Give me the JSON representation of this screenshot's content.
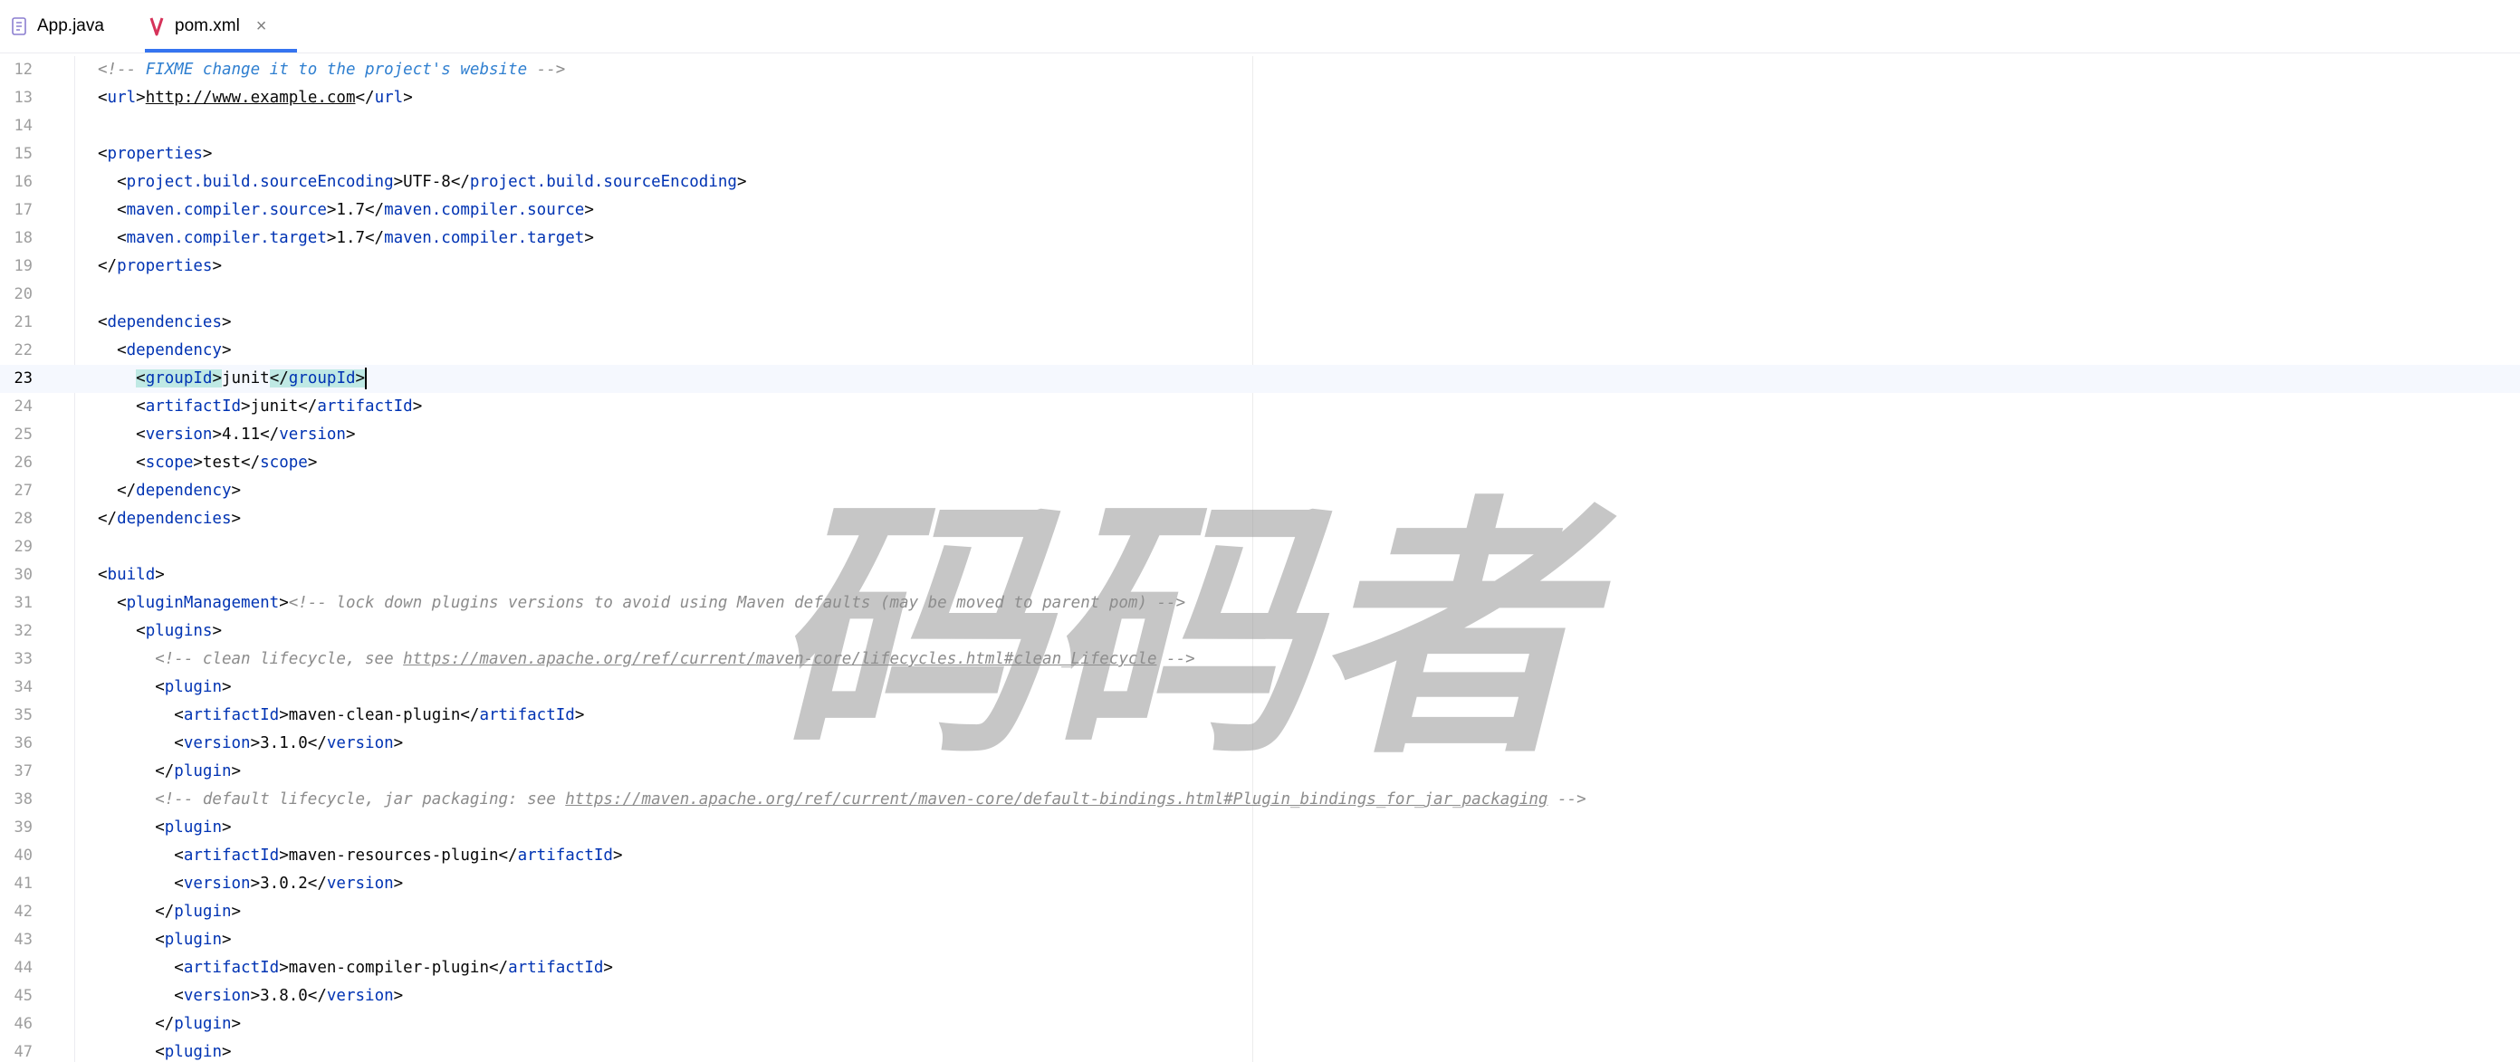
{
  "tabs": [
    {
      "label": "App.java",
      "icon": "java-file-icon",
      "active": false
    },
    {
      "label": "pom.xml",
      "icon": "maven-icon",
      "active": true,
      "close": "×"
    }
  ],
  "editor": {
    "current_line": 23,
    "lines": [
      {
        "n": "12",
        "code": "<!-- FIXME change it to the project's website -->"
      },
      {
        "n": "13",
        "code": "<url>http://www.example.com</url>"
      },
      {
        "n": "14",
        "code": ""
      },
      {
        "n": "15",
        "code": "<properties>"
      },
      {
        "n": "16",
        "code": "  <project.build.sourceEncoding>UTF-8</project.build.sourceEncoding>"
      },
      {
        "n": "17",
        "code": "  <maven.compiler.source>1.7</maven.compiler.source>"
      },
      {
        "n": "18",
        "code": "  <maven.compiler.target>1.7</maven.compiler.target>"
      },
      {
        "n": "19",
        "code": "</properties>"
      },
      {
        "n": "20",
        "code": ""
      },
      {
        "n": "21",
        "code": "<dependencies>"
      },
      {
        "n": "22",
        "code": "  <dependency>"
      },
      {
        "n": "23",
        "code": "    <groupId>junit</groupId>"
      },
      {
        "n": "24",
        "code": "    <artifactId>junit</artifactId>"
      },
      {
        "n": "25",
        "code": "    <version>4.11</version>"
      },
      {
        "n": "26",
        "code": "    <scope>test</scope>"
      },
      {
        "n": "27",
        "code": "  </dependency>"
      },
      {
        "n": "28",
        "code": "</dependencies>"
      },
      {
        "n": "29",
        "code": ""
      },
      {
        "n": "30",
        "code": "<build>"
      },
      {
        "n": "31",
        "code": "  <pluginManagement><!-- lock down plugins versions to avoid using Maven defaults (may be moved to parent pom) -->"
      },
      {
        "n": "32",
        "code": "    <plugins>"
      },
      {
        "n": "33",
        "code": "      <!-- clean lifecycle, see https://maven.apache.org/ref/current/maven-core/lifecycles.html#clean_Lifecycle -->"
      },
      {
        "n": "34",
        "code": "      <plugin>"
      },
      {
        "n": "35",
        "code": "        <artifactId>maven-clean-plugin</artifactId>"
      },
      {
        "n": "36",
        "code": "        <version>3.1.0</version>"
      },
      {
        "n": "37",
        "code": "      </plugin>"
      },
      {
        "n": "38",
        "code": "      <!-- default lifecycle, jar packaging: see https://maven.apache.org/ref/current/maven-core/default-bindings.html#Plugin_bindings_for_jar_packaging -->"
      },
      {
        "n": "39",
        "code": "      <plugin>"
      },
      {
        "n": "40",
        "code": "        <artifactId>maven-resources-plugin</artifactId>"
      },
      {
        "n": "41",
        "code": "        <version>3.0.2</version>"
      },
      {
        "n": "42",
        "code": "      </plugin>"
      },
      {
        "n": "43",
        "code": "      <plugin>"
      },
      {
        "n": "44",
        "code": "        <artifactId>maven-compiler-plugin</artifactId>"
      },
      {
        "n": "45",
        "code": "        <version>3.8.0</version>"
      },
      {
        "n": "46",
        "code": "      </plugin>"
      },
      {
        "n": "47",
        "code": "      <plugin>"
      }
    ]
  },
  "watermark": {
    "text": "码码者",
    "color": "#8f8f8f"
  }
}
